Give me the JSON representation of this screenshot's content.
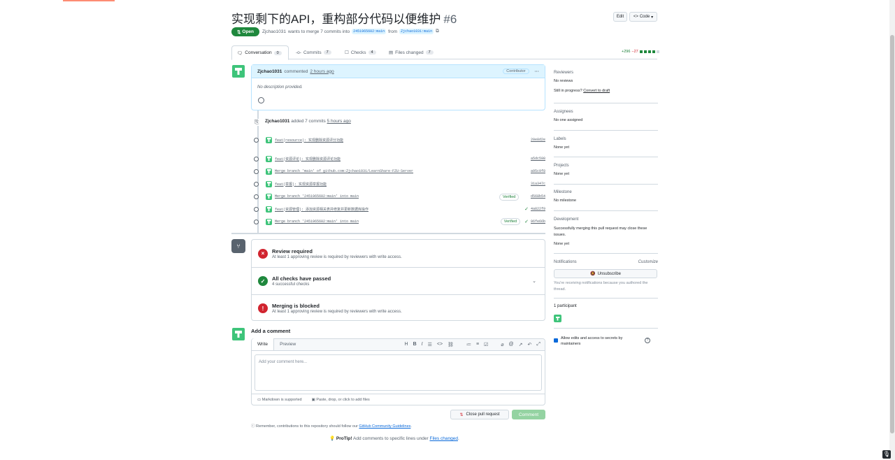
{
  "header": {
    "title": "实现剩下的API，重构部分代码以便维护",
    "number": "#6",
    "edit_label": "Edit",
    "code_label": "Code"
  },
  "status": {
    "state": "Open",
    "author": "Zjchao1031",
    "text": "wants to merge 7 commits into",
    "base": "2451965602:main",
    "from": "from",
    "head": "Zjchao1031:main"
  },
  "tabs": [
    {
      "label": "Conversation",
      "count": "0"
    },
    {
      "label": "Commits",
      "count": "7"
    },
    {
      "label": "Checks",
      "count": "4"
    },
    {
      "label": "Files changed",
      "count": "7"
    }
  ],
  "diffstat": {
    "additions": "+296",
    "deletions": "−27"
  },
  "comment": {
    "author": "Zjchao1031",
    "action": "commented",
    "time": "2 hours ago",
    "role": "Contributor",
    "body": "No description provided."
  },
  "pushed": {
    "author": "Zjchao1031",
    "text": "added 7 commits",
    "time": "5 hours ago"
  },
  "commits": [
    {
      "message": "feat(resource): 实现删除资源评分功能",
      "sha": "20e8d2e",
      "verified": "",
      "check": false
    },
    {
      "message": "feat(资源评论): 实现删除资源评论功能",
      "sha": "a5dc598",
      "verified": "",
      "check": false
    },
    {
      "message": "Merge branch 'main' of github.com:Zjchao1031/LearnShare-FZU-Server",
      "sha": "a95c9f8",
      "verified": "",
      "check": false
    },
    {
      "message": "feat(举报): 实现资源举报功能",
      "sha": "31a347c",
      "verified": "",
      "check": false
    },
    {
      "message": "Merge branch '2451965602:main' into main",
      "sha": "d568b54",
      "verified": "Verified",
      "check": false
    },
    {
      "message": "feat(资源管理): 添加资源相关表并修复并更新数据库操作",
      "sha": "4a822f9",
      "verified": "",
      "check": true
    },
    {
      "message": "Merge branch '2451965602:main' into main",
      "sha": "96fe66b",
      "verified": "Verified",
      "check": true
    }
  ],
  "merge": {
    "review_title": "Review required",
    "review_sub": "At least 1 approving review is required by reviewers with write access.",
    "checks_title": "All checks have passed",
    "checks_sub": "4 successful checks",
    "blocked_title": "Merging is blocked",
    "blocked_sub": "At least 1 approving review is required by reviewers with write access."
  },
  "editor": {
    "heading": "Add a comment",
    "write_tab": "Write",
    "preview_tab": "Preview",
    "placeholder": "Add your comment here...",
    "markdown_note": "Markdown is supported",
    "attach_note": "Paste, drop, or click to add files",
    "close_label": "Close pull request",
    "comment_label": "Comment"
  },
  "footer": {
    "remember": "Remember, contributions to this repository should follow our",
    "guidelines": "GitHub Community Guidelines",
    "protip_label": "ProTip!",
    "protip_text": "Add comments to specific lines under",
    "protip_link": "Files changed"
  },
  "sidebar": {
    "reviewers_h": "Reviewers",
    "reviewers_v": "No reviews",
    "in_progress": "Still in progress?",
    "convert": "Convert to draft",
    "assignees_h": "Assignees",
    "assignees_v": "No one assigned",
    "labels_h": "Labels",
    "labels_v": "None yet",
    "projects_h": "Projects",
    "projects_v": "None yet",
    "milestone_h": "Milestone",
    "milestone_v": "No milestone",
    "development_h": "Development",
    "development_text": "Successfully merging this pull request may close these issues.",
    "development_v": "None yet",
    "notifications_h": "Notifications",
    "customize": "Customize",
    "unsubscribe": "Unsubscribe",
    "notif_note": "You're receiving notifications because you authored the thread.",
    "participants": "1 participant",
    "allow_edits": "Allow edits and access to secrets by maintainers"
  },
  "colors": {
    "open_green": "#1f883d",
    "link_blue": "#0969da",
    "danger_red": "#d1242f"
  }
}
